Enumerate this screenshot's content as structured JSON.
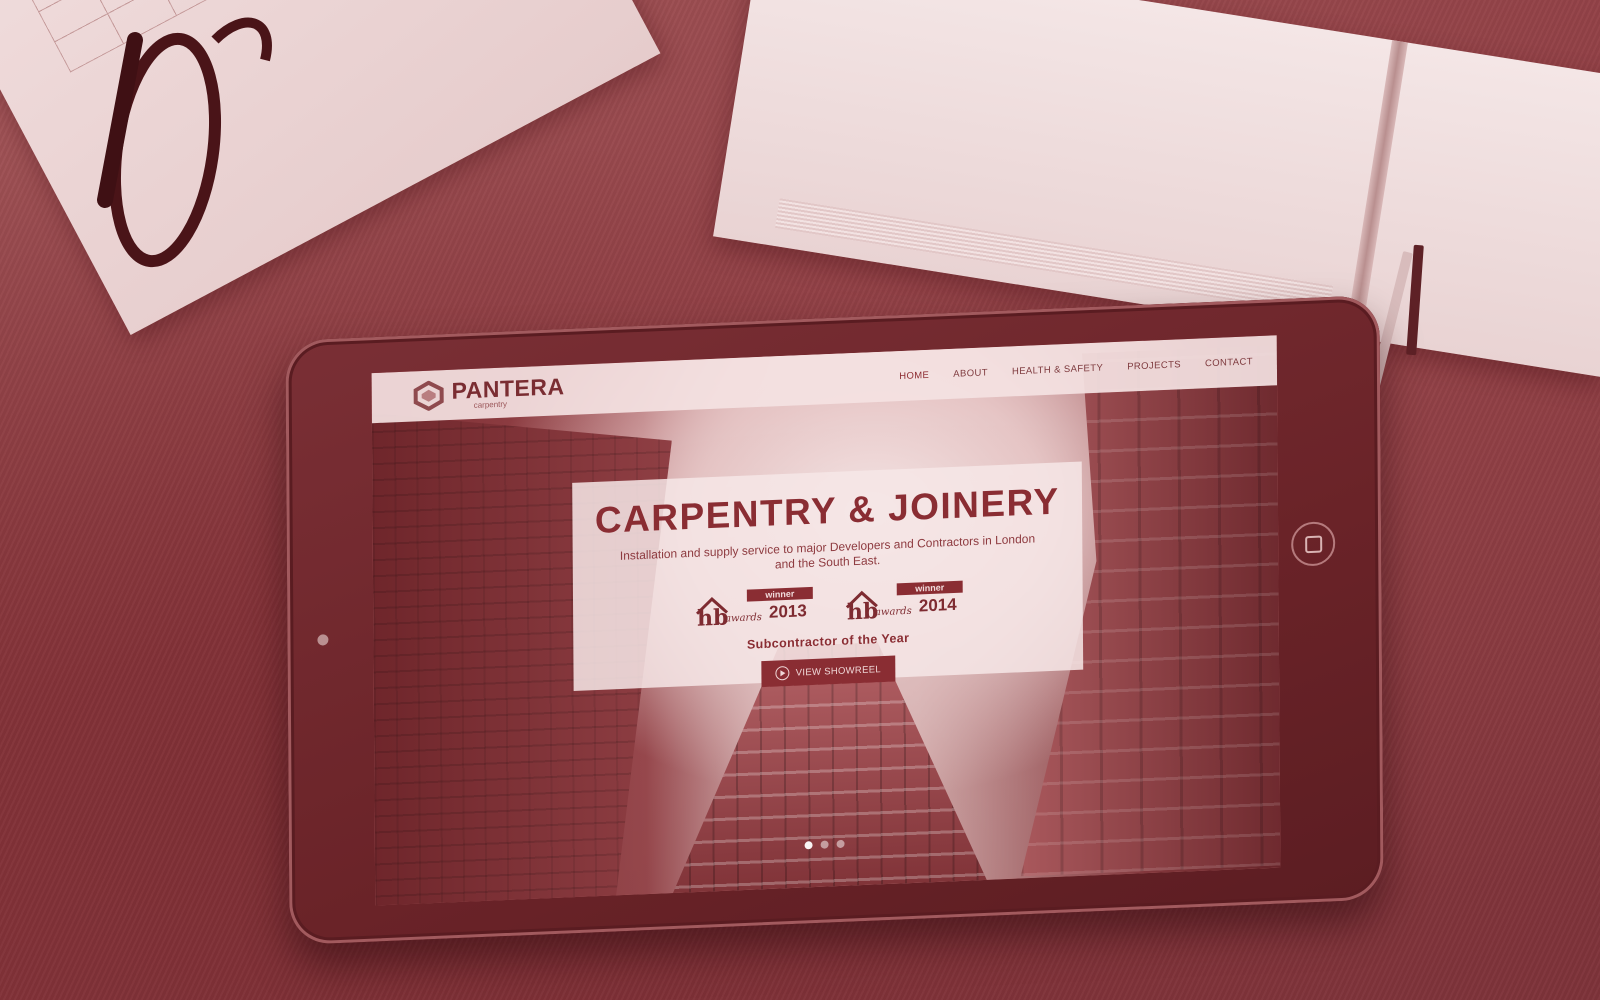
{
  "site": {
    "logo_name": "PANTERA",
    "logo_sub": "carpentry",
    "nav": [
      {
        "label": "HOME",
        "active": true
      },
      {
        "label": "ABOUT",
        "active": false
      },
      {
        "label": "HEALTH & SAFETY",
        "active": false
      },
      {
        "label": "PROJECTS",
        "active": false
      },
      {
        "label": "CONTACT",
        "active": false
      }
    ]
  },
  "hero": {
    "title": "CARPENTRY & JOINERY",
    "subtitle": "Installation and supply service to major Developers and Contractors in London and the South East.",
    "awards": [
      {
        "brand": "hb",
        "word": "awards",
        "badge": "winner",
        "year": "2013"
      },
      {
        "brand": "hb",
        "word": "awards",
        "badge": "winner",
        "year": "2014"
      }
    ],
    "award_caption": "Subcontractor of the Year",
    "cta_label": "VIEW SHOWREEL"
  },
  "slider": {
    "count": 3,
    "active_index": 0
  },
  "colors": {
    "brand": "#8a2d33",
    "header_bg": "#f4e2e2",
    "tint": "#8e3d42"
  },
  "icons": {
    "logo": "pantera-logo-icon",
    "cta": "play-icon",
    "home_button": "home-button-icon"
  }
}
